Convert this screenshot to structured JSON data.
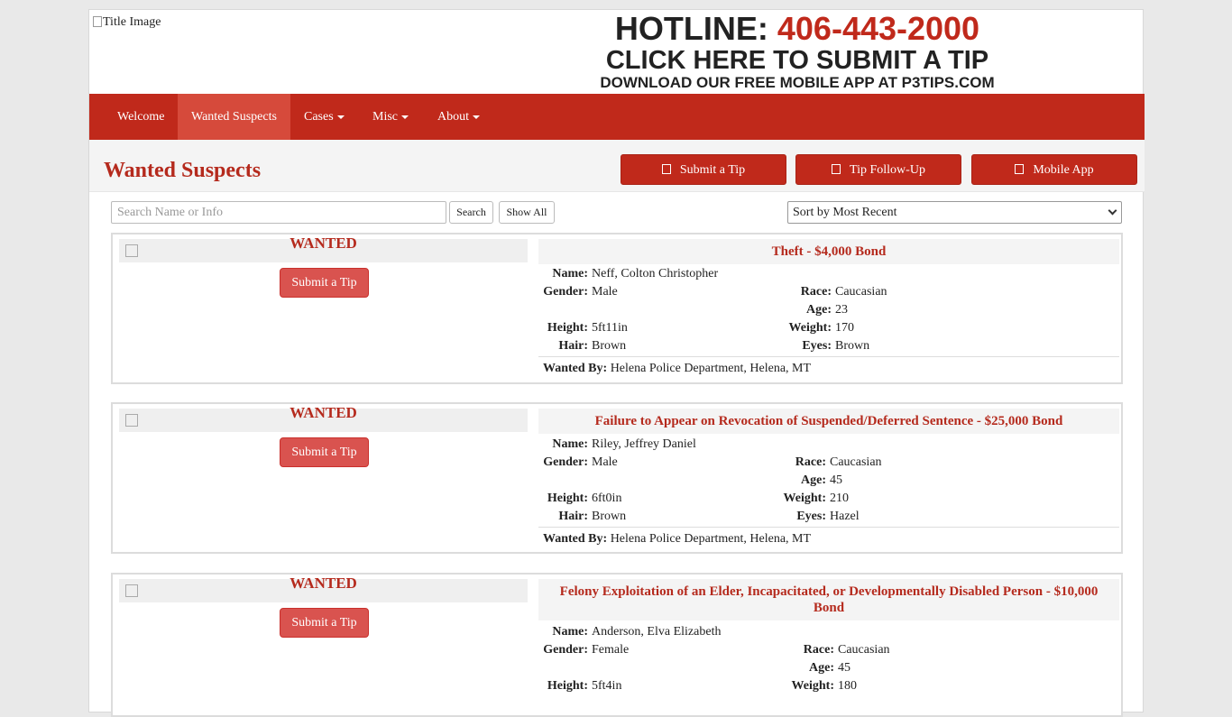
{
  "header": {
    "title_image_alt": "Title Image",
    "hotline_label": "HOTLINE:",
    "hotline_number": "406-443-2000",
    "submit_tip_text": "CLICK HERE TO SUBMIT A TIP",
    "app_text": "DOWNLOAD OUR FREE MOBILE APP AT P3TIPS.COM"
  },
  "nav": {
    "items": [
      {
        "label": "Welcome"
      },
      {
        "label": "Wanted Suspects"
      },
      {
        "label": "Cases"
      },
      {
        "label": "Misc"
      },
      {
        "label": "About"
      }
    ]
  },
  "page": {
    "title": "Wanted Suspects",
    "buttons": [
      "Submit a Tip",
      "Tip Follow-Up",
      "Mobile App"
    ]
  },
  "search": {
    "placeholder": "Search Name or Info",
    "search_label": "Search",
    "show_all_label": "Show All",
    "sort_selected": "Sort by Most Recent"
  },
  "labels": {
    "wanted": "WANTED",
    "submit_tip": "Submit a Tip",
    "name": "Name:",
    "gender": "Gender:",
    "race": "Race:",
    "age": "Age:",
    "height": "Height:",
    "weight": "Weight:",
    "hair": "Hair:",
    "eyes": "Eyes:",
    "wanted_by": "Wanted By:"
  },
  "suspects": [
    {
      "charge": "Theft - $4,000 Bond",
      "name": "Neff, Colton Christopher",
      "gender": "Male",
      "race": "Caucasian",
      "age": "23",
      "height": "5ft11in",
      "weight": "170",
      "hair": "Brown",
      "eyes": "Brown",
      "wanted_by": "Helena Police Department, Helena, MT"
    },
    {
      "charge": "Failure to Appear on Revocation of Suspended/Deferred Sentence - $25,000 Bond",
      "name": "Riley, Jeffrey Daniel",
      "gender": "Male",
      "race": "Caucasian",
      "age": "45",
      "height": "6ft0in",
      "weight": "210",
      "hair": "Brown",
      "eyes": "Hazel",
      "wanted_by": "Helena Police Department, Helena, MT"
    },
    {
      "charge": "Felony Exploitation of an Elder, Incapacitated, or Developmentally Disabled Person - $10,000 Bond",
      "name": "Anderson, Elva Elizabeth",
      "gender": "Female",
      "race": "Caucasian",
      "age": "45",
      "height": "5ft4in",
      "weight": "180"
    }
  ]
}
